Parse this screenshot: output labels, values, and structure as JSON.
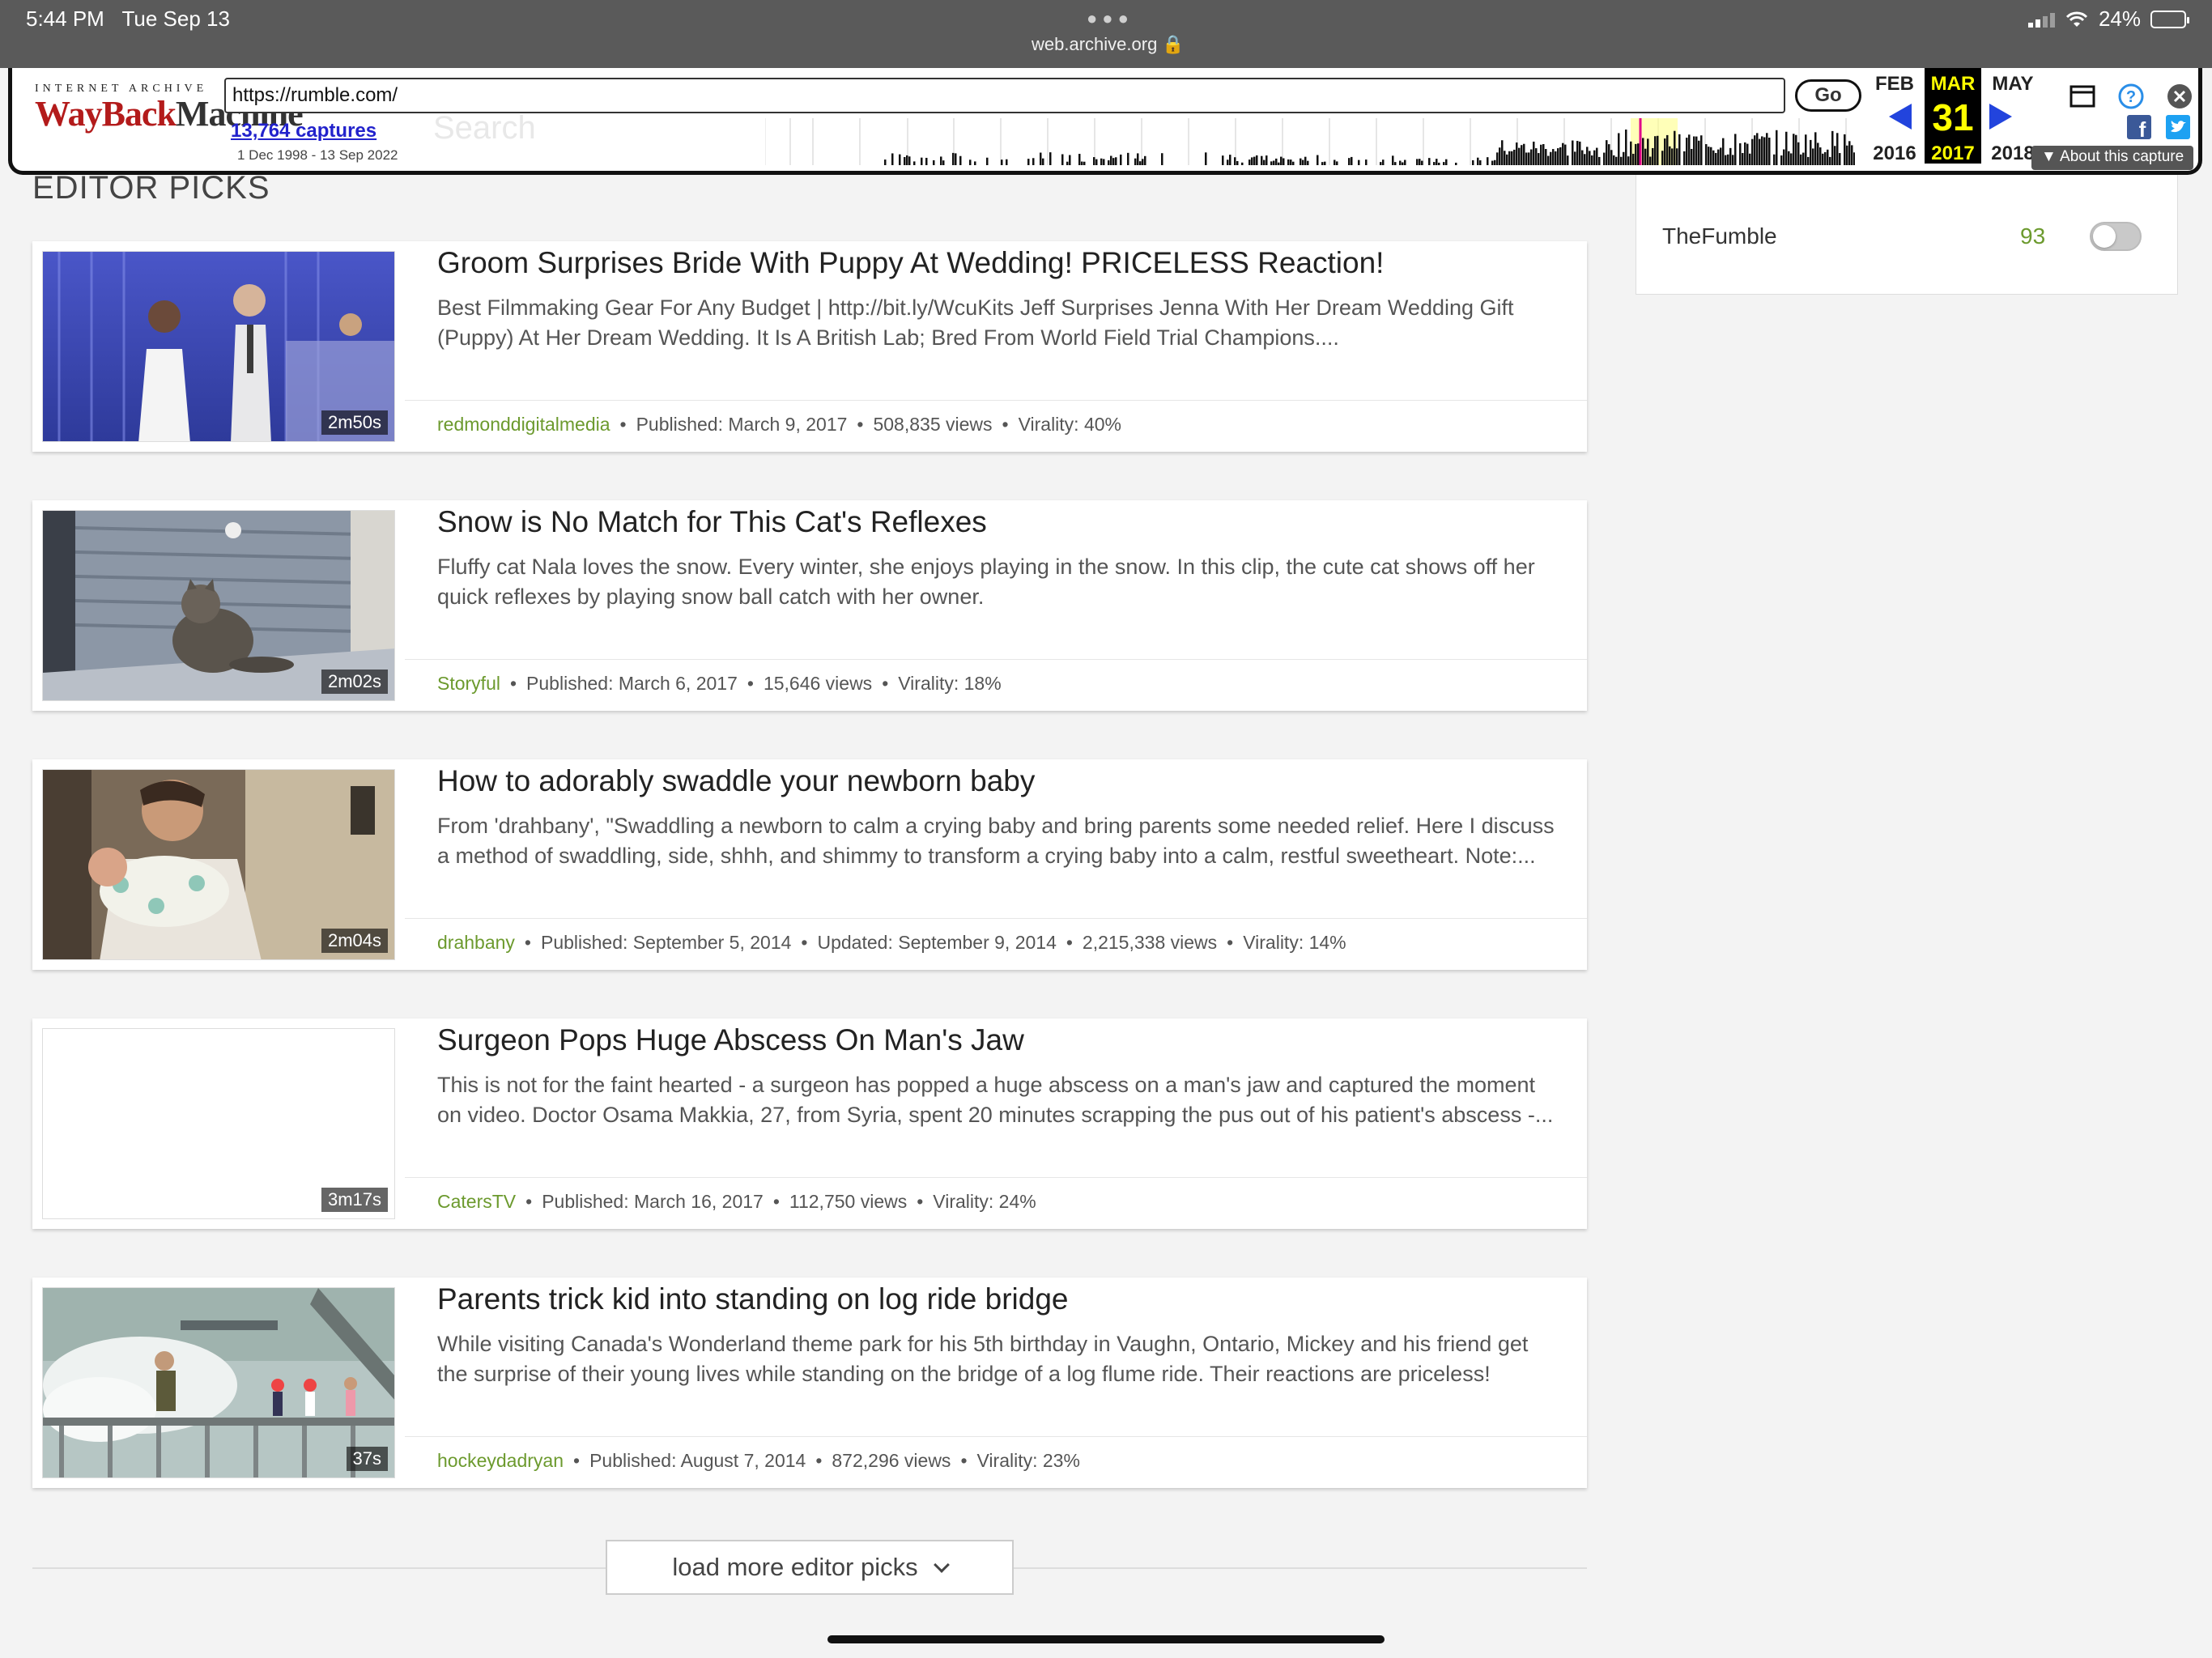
{
  "status_bar": {
    "time": "5:44 PM",
    "date": "Tue Sep 13",
    "url": "web.archive.org 🔒",
    "battery": "24%",
    "battery_level": 0.24
  },
  "wayback": {
    "logo_top": "INTERNET ARCHIVE",
    "logo_main_red": "WayBack",
    "logo_main_dark": "Machine",
    "url_value": "https://rumble.com/",
    "go_label": "Go",
    "captures": "13,764 captures",
    "range": "1 Dec 1998 - 13 Sep 2022",
    "ghost_search": "Search",
    "prev_month": "FEB",
    "cur_month": "MAR",
    "next_month": "MAY",
    "cur_day": "31",
    "prev_year": "2016",
    "cur_year": "2017",
    "next_year": "2018",
    "about_label": "▼ About this capture"
  },
  "section_title": "EDITOR PICKS",
  "sidebar": {
    "name": "TheFumble",
    "count": "93",
    "toggle_on": false
  },
  "cards": [
    {
      "title": "Groom Surprises Bride With Puppy At Wedding! PRICELESS Reaction!",
      "desc": "Best Filmmaking Gear For Any Budget | http://bit.ly/WcuKits Jeff Surprises Jenna With Her Dream Wedding Gift (Puppy) At Her Dream Wedding. It Is A British Lab; Bred From World Field Trial Champions....",
      "duration": "2m50s",
      "author": "redmonddigitalmedia",
      "published": "Published: March 9, 2017",
      "views": "508,835 views",
      "virality": "Virality: 40%"
    },
    {
      "title": "Snow is No Match for This Cat's Reflexes",
      "desc": "Fluffy cat Nala loves the snow. Every winter, she enjoys playing in the snow. In this clip, the cute cat shows off her quick reflexes by playing snow ball catch with her owner.",
      "duration": "2m02s",
      "author": "Storyful",
      "published": "Published: March 6, 2017",
      "views": "15,646 views",
      "virality": "Virality: 18%"
    },
    {
      "title": "How to adorably swaddle your newborn baby",
      "desc": "From 'drahbany', \"Swaddling a newborn to calm a crying baby and bring parents some needed relief. Here I discuss a method of swaddling, side, shhh, and shimmy to transform a crying baby into a calm, restful sweetheart. Note:...",
      "duration": "2m04s",
      "author": "drahbany",
      "published": "Published: September 5, 2014",
      "updated": "Updated: September 9, 2014",
      "views": "2,215,338 views",
      "virality": "Virality: 14%"
    },
    {
      "title": "Surgeon Pops Huge Abscess On Man's Jaw",
      "desc": "This is not for the faint hearted - a surgeon has popped a huge abscess on a man's jaw and captured the moment on video. Doctor Osama Makkia, 27, from Syria, spent 20 minutes scrapping the pus out of his patient's abscess -...",
      "duration": "3m17s",
      "author": "CatersTV",
      "published": "Published: March 16, 2017",
      "views": "112,750 views",
      "virality": "Virality: 24%"
    },
    {
      "title": "Parents trick kid into standing on log ride bridge",
      "desc": "While visiting Canada's Wonderland theme park for his 5th birthday in Vaughn, Ontario, Mickey and his friend get the surprise of their young lives while standing on the bridge of a log flume ride. Their reactions are priceless!",
      "duration": "37s",
      "author": "hockeydadryan",
      "published": "Published: August 7, 2014",
      "views": "872,296 views",
      "virality": "Virality: 23%"
    }
  ],
  "load_more_label": "load more editor picks"
}
